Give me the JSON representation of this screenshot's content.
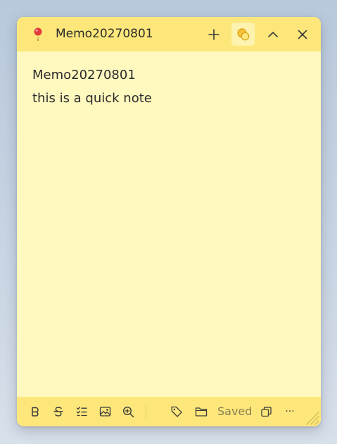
{
  "window": {
    "title": "Memo20270801",
    "buttons": {
      "new_note": "plus-icon",
      "color_theme": "color-palette-icon",
      "collapse": "chevron-up-icon",
      "close": "close-icon"
    },
    "accent_color": "#fde77b",
    "body_color": "#fff8bf"
  },
  "note": {
    "lines": [
      "Memo20270801",
      "this is a quick note"
    ]
  },
  "toolbar": {
    "items": [
      "bold-icon",
      "strikethrough-icon",
      "checklist-icon",
      "image-icon",
      "zoom-icon",
      "tag-icon",
      "folder-icon"
    ],
    "status": "Saved",
    "more": "···"
  }
}
